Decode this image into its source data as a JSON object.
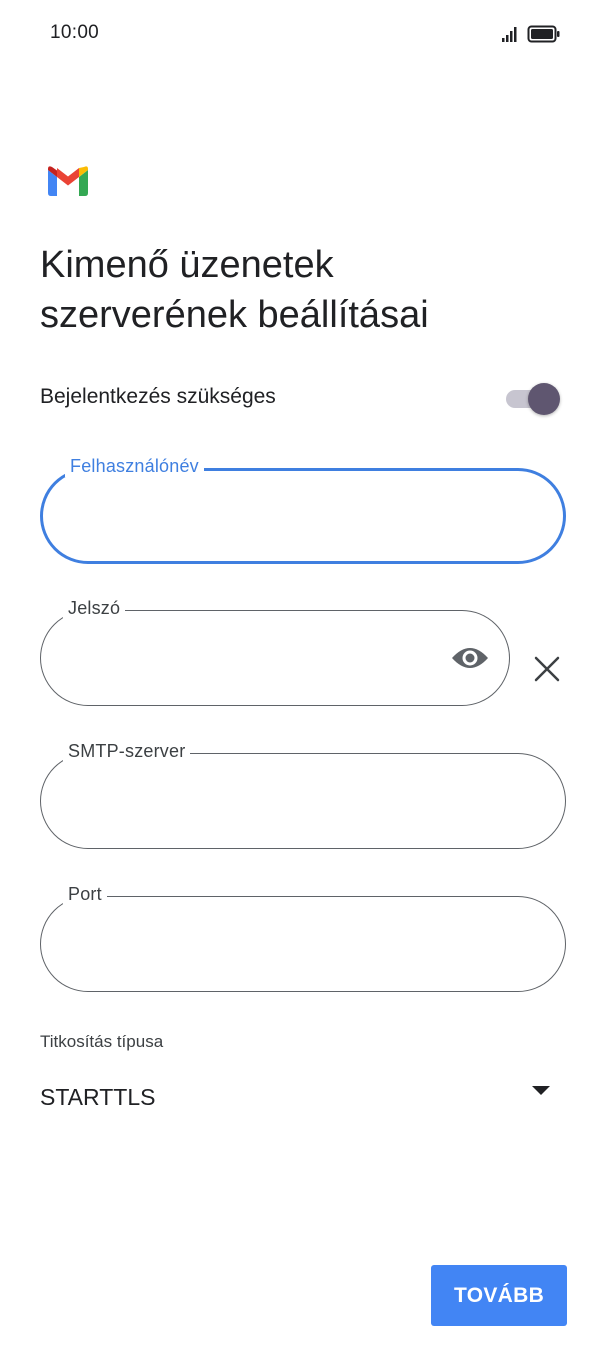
{
  "status_bar": {
    "time": "10:00",
    "icons": [
      "signal-icon",
      "battery-icon"
    ]
  },
  "app": {
    "logo": "gmail-logo"
  },
  "page": {
    "title_line1": "Kimenő üzenetek",
    "title_line2": "szerverének beállításai"
  },
  "login_required": {
    "label": "Bejelentkezés szükséges",
    "enabled": true
  },
  "fields": {
    "username": {
      "label": "Felhasználónév",
      "value": ""
    },
    "password": {
      "label": "Jelszó",
      "value": ""
    },
    "smtp_server": {
      "label": "SMTP-szerver",
      "value": ""
    },
    "port": {
      "label": "Port",
      "value": ""
    }
  },
  "encryption": {
    "label": "Titkosítás típusa",
    "value": "STARTTLS"
  },
  "actions": {
    "next_label": "TOVÁBB"
  },
  "colors": {
    "accent": "#3f7fe0",
    "button": "#4285f4",
    "toggle_thumb": "#5f5670"
  }
}
